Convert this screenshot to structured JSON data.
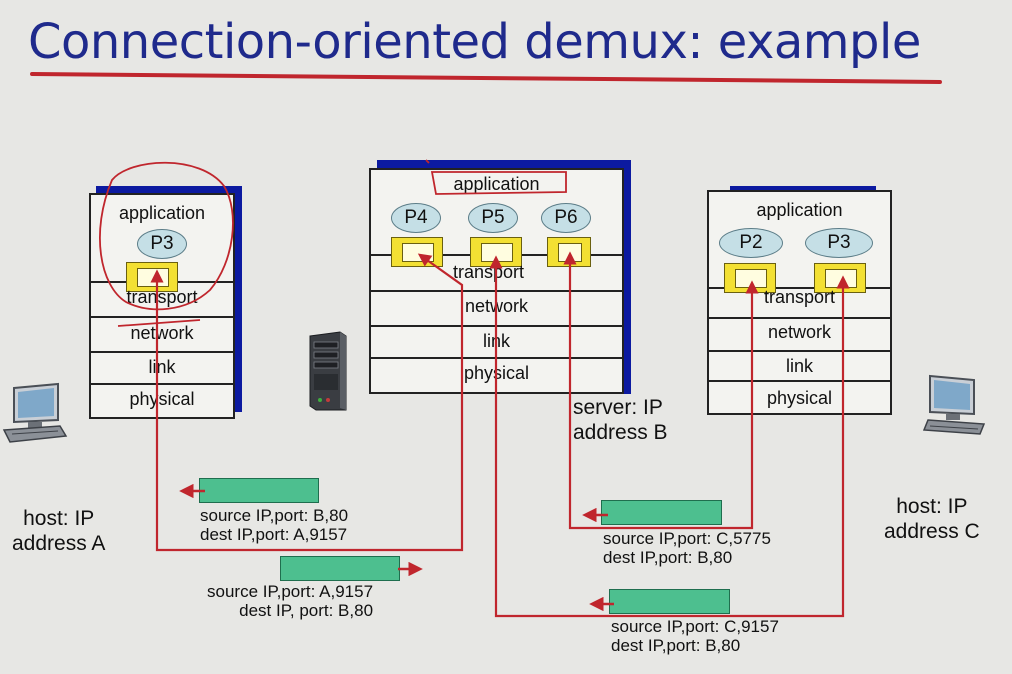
{
  "slide": {
    "title": "Connection-oriented demux: example"
  },
  "host_a": {
    "label_line1": "host: IP",
    "label_line2": "address A",
    "layers": [
      "application",
      "transport",
      "network",
      "link",
      "physical"
    ],
    "processes": [
      "P3"
    ]
  },
  "server_b": {
    "label_line1": "server: IP",
    "label_line2": "address B",
    "layers": [
      "application",
      "transport",
      "network",
      "link",
      "physical"
    ],
    "processes": [
      "P4",
      "P5",
      "P6"
    ]
  },
  "host_c": {
    "label_line1": "host: IP",
    "label_line2": "address C",
    "layers": [
      "application",
      "transport",
      "network",
      "link",
      "physical"
    ],
    "processes": [
      "P2",
      "P3"
    ]
  },
  "segments": [
    {
      "line1": "source IP,port: B,80",
      "line2": "dest IP,port: A,9157"
    },
    {
      "line1": "source IP,port: A,9157",
      "line2": "dest IP, port: B,80"
    },
    {
      "line1": "source IP,port: C,5775",
      "line2": "dest IP,port: B,80"
    },
    {
      "line1": "source IP,port: C,9157",
      "line2": "dest IP,port: B,80"
    }
  ],
  "colors": {
    "title": "#1f2a8c",
    "annotation_red": "#c0262d",
    "segment_green": "#4dbf8f",
    "socket_yellow": "#f3e033",
    "stack_shadow": "#0c1aa0",
    "process_blue": "#c5dfe6"
  }
}
